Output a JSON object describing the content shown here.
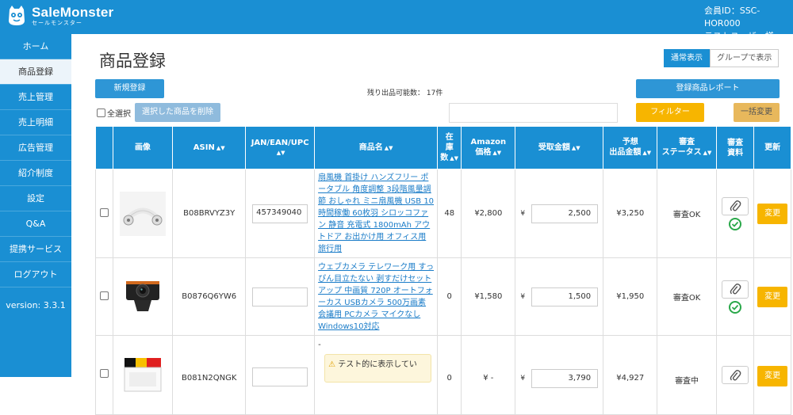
{
  "header": {
    "brand": "SaleMonster",
    "brand_sub": "セールモンスター",
    "member_id": "会員ID：SSC-HOR000",
    "user_name": "テストユーザー様"
  },
  "sidebar": {
    "items": [
      {
        "label": "ホーム",
        "active": false
      },
      {
        "label": "商品登録",
        "active": true
      },
      {
        "label": "売上管理",
        "active": false
      },
      {
        "label": "売上明細",
        "active": false
      },
      {
        "label": "広告管理",
        "active": false
      },
      {
        "label": "紹介制度",
        "active": false
      },
      {
        "label": "設定",
        "active": false
      },
      {
        "label": "Q&A",
        "active": false
      },
      {
        "label": "提携サービス",
        "active": false
      },
      {
        "label": "ログアウト",
        "active": false
      }
    ],
    "version": "version: 3.3.1"
  },
  "page": {
    "title": "商品登録",
    "view_normal": "通常表示",
    "view_group": "グループで表示",
    "new_button": "新規登録",
    "remaining": "残り出品可能数： 17件",
    "report_button": "登録商品レポート",
    "select_all": "全選択",
    "delete_selected": "選択した商品を削除",
    "filter_button": "フィルター",
    "bulk_edit": "一括変更",
    "filter_value": ""
  },
  "table": {
    "headers": {
      "image": "画像",
      "asin": "ASIN",
      "jan": "JAN/EAN/UPC",
      "name": "商品名",
      "stock_1": "在",
      "stock_2": "庫",
      "stock_3": "数",
      "amazon_1": "Amazon",
      "amazon_2": "価格",
      "receive": "受取金額",
      "expected_1": "予想",
      "expected_2": "出品金額",
      "status_1": "審査",
      "status_2": "ステータス",
      "docs_1": "審査",
      "docs_2": "資料",
      "update": "更新"
    },
    "rows": [
      {
        "asin": "B08BRVYZ3Y",
        "jan": "457349040",
        "name": "扇風機 首掛け ハンズフリー ポータブル 角度調整 3段階風量調節 おしゃれ ミニ扇風機 USB 10時間稼働 60枚羽 シロッコファン 静音 充電式 1800mAh アウトドア お出かけ用 オフィス用 旅行用",
        "stock": "48",
        "amazon_price": "¥2,800",
        "yen": "¥",
        "receive": "2,500",
        "expected": "¥3,250",
        "status": "審査OK",
        "edit": "変更"
      },
      {
        "asin": "B0876Q6YW6",
        "jan": "",
        "name": "ウェブカメラ テレワーク用 すっぴん目立たない 剥すだけセットアップ 中画質 720P オートフォーカス USBカメラ 500万画素 会議用 PCカメラ マイクなし Windows10対応",
        "stock": "0",
        "amazon_price": "¥1,580",
        "yen": "¥",
        "receive": "1,500",
        "expected": "¥1,950",
        "status": "審査OK",
        "edit": "変更"
      },
      {
        "asin": "B081N2QNGK",
        "jan": "",
        "name": "-",
        "warning": "テスト的に表示してい",
        "stock": "0",
        "amazon_price": "¥ -",
        "yen": "¥",
        "receive": "3,790",
        "expected": "¥4,927",
        "status": "審査中",
        "edit": "変更"
      }
    ]
  }
}
